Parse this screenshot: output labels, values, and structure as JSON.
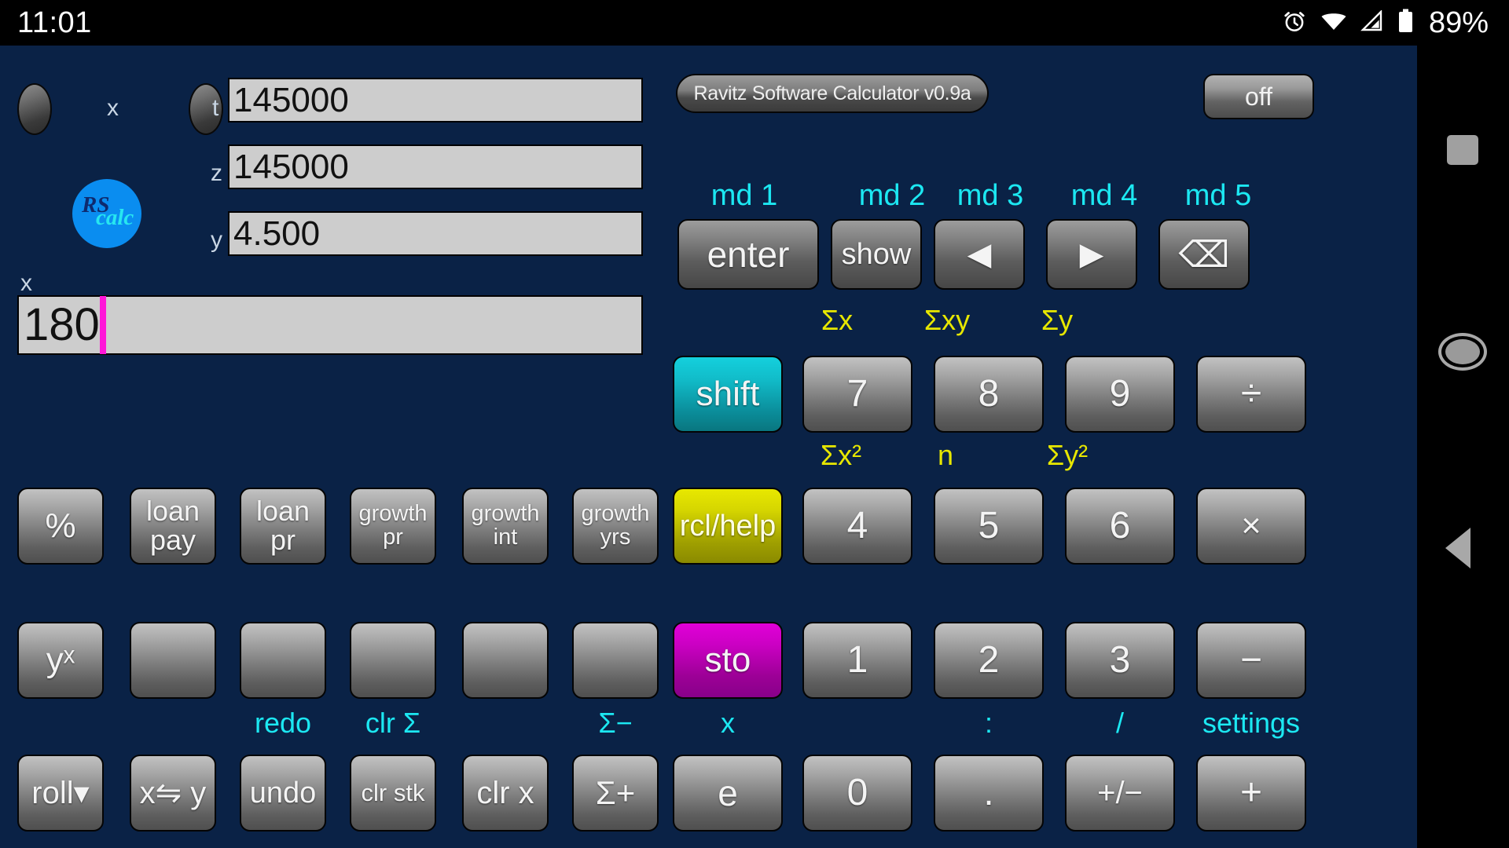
{
  "statusbar": {
    "time": "11:01",
    "battery_percent": "89%",
    "icons": [
      "alarm-icon",
      "wifi-icon",
      "cellular-signal-icon",
      "battery-icon"
    ]
  },
  "navrail": {
    "recents_label": "recents",
    "home_label": "home",
    "back_label": "back"
  },
  "app": {
    "title": "Ravitz Software Calculator v0.9a",
    "off_label": "off",
    "logo": {
      "top": "RS",
      "bottom": "calc"
    },
    "accent_colors": {
      "background": "#0a2246",
      "shift_cyan": "#11bcc9",
      "rcl_yellow": "#d6d600",
      "sto_magenta": "#cc00c4",
      "legend_cyan": "#1ce8f2",
      "legend_yellow": "#e7e700",
      "caret_magenta": "#ff16d8",
      "display_grey": "#cdcdcd"
    }
  },
  "stack": {
    "tag_x_top": "x",
    "rows": [
      {
        "tag": "t",
        "value": "145000"
      },
      {
        "tag": "z",
        "value": "145000"
      },
      {
        "tag": "y",
        "value": "4.500"
      }
    ],
    "entry": {
      "tag": "x",
      "value": "180"
    }
  },
  "mode_labels": [
    "md 1",
    "md 2",
    "md 3",
    "md 4",
    "md 5"
  ],
  "top_keys": [
    {
      "label": "enter",
      "name": "enter-key"
    },
    {
      "label": "show",
      "name": "show-key"
    },
    {
      "label": "◀",
      "name": "left-arrow-key"
    },
    {
      "label": "▶",
      "name": "right-arrow-key"
    },
    {
      "label": "⌫",
      "name": "backspace-key"
    }
  ],
  "legends_row_7": [
    "Σx",
    "Σxy",
    "Σy"
  ],
  "legends_row_4": [
    "Σx²",
    "n",
    "Σy²"
  ],
  "legends_bottom": [
    "redo",
    "clr Σ",
    "Σ−",
    "x",
    ":",
    "/",
    "settings"
  ],
  "function_keys": [
    {
      "label": "%",
      "name": "percent-key"
    },
    {
      "label": "loan\npay",
      "name": "loan-pay-key"
    },
    {
      "label": "loan\npr",
      "name": "loan-pr-key"
    },
    {
      "label": "growth\npr",
      "name": "growth-pr-key"
    },
    {
      "label": "growth\nint",
      "name": "growth-int-key"
    },
    {
      "label": "growth\nyrs",
      "name": "growth-yrs-key"
    }
  ],
  "power_row": [
    {
      "label": "yˣ",
      "name": "y-to-x-key"
    },
    {
      "label": "",
      "name": "blank-key-1"
    },
    {
      "label": "",
      "name": "blank-key-2"
    },
    {
      "label": "",
      "name": "blank-key-3"
    },
    {
      "label": "",
      "name": "blank-key-4"
    },
    {
      "label": "",
      "name": "blank-key-5"
    }
  ],
  "stack_ops_row": [
    {
      "label": "roll▾",
      "name": "roll-down-key"
    },
    {
      "label": "x⇋ y",
      "name": "swap-xy-key"
    },
    {
      "label": "undo",
      "name": "undo-key"
    },
    {
      "label": "clr stk",
      "name": "clear-stack-key"
    },
    {
      "label": "clr x",
      "name": "clear-x-key"
    },
    {
      "label": "Σ+",
      "name": "sigma-plus-key"
    }
  ],
  "modifier_keys": [
    {
      "label": "shift",
      "name": "shift-key",
      "color": "cyan"
    },
    {
      "label": "rcl/help",
      "name": "rcl-help-key",
      "color": "yellow"
    },
    {
      "label": "sto",
      "name": "sto-key",
      "color": "magenta"
    },
    {
      "label": "e",
      "name": "exponent-key",
      "color": "grey"
    }
  ],
  "numpad": [
    {
      "label": "7",
      "name": "digit-7-key"
    },
    {
      "label": "8",
      "name": "digit-8-key"
    },
    {
      "label": "9",
      "name": "digit-9-key"
    },
    {
      "label": "÷",
      "name": "divide-key"
    },
    {
      "label": "4",
      "name": "digit-4-key"
    },
    {
      "label": "5",
      "name": "digit-5-key"
    },
    {
      "label": "6",
      "name": "digit-6-key"
    },
    {
      "label": "×",
      "name": "multiply-key"
    },
    {
      "label": "1",
      "name": "digit-1-key"
    },
    {
      "label": "2",
      "name": "digit-2-key"
    },
    {
      "label": "3",
      "name": "digit-3-key"
    },
    {
      "label": "−",
      "name": "minus-key"
    },
    {
      "label": "0",
      "name": "digit-0-key"
    },
    {
      "label": ".",
      "name": "decimal-point-key"
    },
    {
      "label": "+/−",
      "name": "sign-toggle-key"
    },
    {
      "label": "+",
      "name": "plus-key"
    }
  ]
}
